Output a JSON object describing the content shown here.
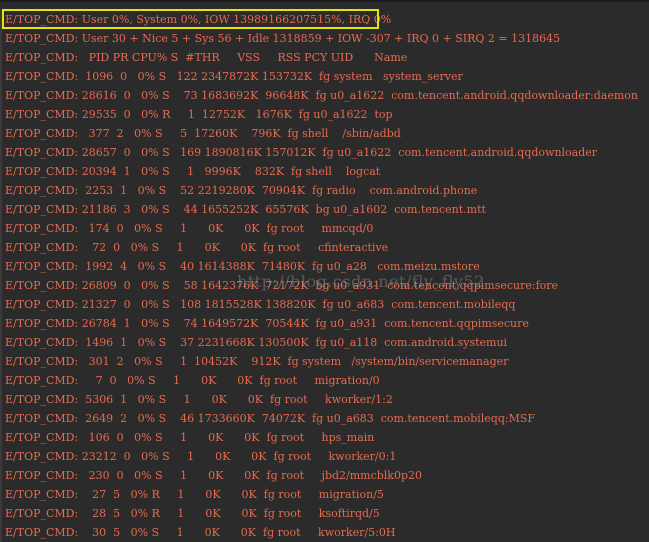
{
  "console": {
    "lines": [
      "E/TOP_CMD: User 0%, System 0%, IOW 13989166207515%, IRQ 0%",
      "E/TOP_CMD: User 30 + Nice 5 + Sys 56 + Idle 1318859 + IOW -307 + IRQ 0 + SIRQ 2 = 1318645",
      "E/TOP_CMD:   PID PR CPU% S  #THR     VSS     RSS PCY UID      Name",
      "E/TOP_CMD:  1096  0   0% S   122 2347872K 153732K  fg system   system_server",
      "E/TOP_CMD: 28616  0   0% S    73 1683692K  96648K  fg u0_a1622  com.tencent.android.qqdownloader:daemon",
      "E/TOP_CMD: 29535  0   0% R     1  12752K   1676K  fg u0_a1622  top",
      "E/TOP_CMD:   377  2   0% S     5  17260K    796K  fg shell    /sbin/adbd",
      "E/TOP_CMD: 28657  0   0% S   169 1890816K 157012K  fg u0_a1622  com.tencent.android.qqdownloader",
      "E/TOP_CMD: 20394  1   0% S     1   9996K    832K  fg shell    logcat",
      "E/TOP_CMD:  2253  1   0% S    52 2219280K  70904K  fg radio    com.android.phone",
      "E/TOP_CMD: 21186  3   0% S    44 1655252K  65576K  bg u0_a1602  com.tencent.mtt",
      "E/TOP_CMD:   174  0   0% S     1      0K      0K  fg root     mmcqd/0",
      "E/TOP_CMD:    72  0   0% S     1      0K      0K  fg root     cfinteractive",
      "E/TOP_CMD:  1992  4   0% S    40 1614388K  71480K  fg u0_a28   com.meizu.mstore",
      "E/TOP_CMD: 26809  0   0% S    58 1642376K  72172K  bg u0_a931  com.tencent.qqpimsecure:fore",
      "E/TOP_CMD: 21327  0   0% S   108 1815528K 138820K  fg u0_a683  com.tencent.mobileqq",
      "E/TOP_CMD: 26784  1   0% S    74 1649572K  70544K  fg u0_a931  com.tencent.qqpimsecure",
      "E/TOP_CMD:  1496  1   0% S    37 2231668K 130500K  fg u0_a118  com.android.systemui",
      "E/TOP_CMD:   301  2   0% S     1  10452K    912K  fg system   /system/bin/servicemanager",
      "E/TOP_CMD:     7  0   0% S     1      0K      0K  fg root     migration/0",
      "E/TOP_CMD:  5306  1   0% S     1      0K      0K  fg root     kworker/1:2",
      "E/TOP_CMD:  2649  2   0% S    46 1733660K  74072K  fg u0_a683  com.tencent.mobileqq:MSF",
      "E/TOP_CMD:   106  0   0% S     1      0K      0K  fg root     hps_main",
      "E/TOP_CMD: 23212  0   0% S     1      0K      0K  fg root     kworker/0:1",
      "E/TOP_CMD:   230  0   0% S     1      0K      0K  fg root     jbd2/mmcblk0p20",
      "E/TOP_CMD:    27  5   0% R     1      0K      0K  fg root     migration/5",
      "E/TOP_CMD:    28  5   0% R     1      0K      0K  fg root     ksoftirqd/5",
      "E/TOP_CMD:    30  5   0% S     1      0K      0K  fg root     kworker/5:0H"
    ]
  },
  "watermark": "http://blog.csdn.net/fly_fly52"
}
